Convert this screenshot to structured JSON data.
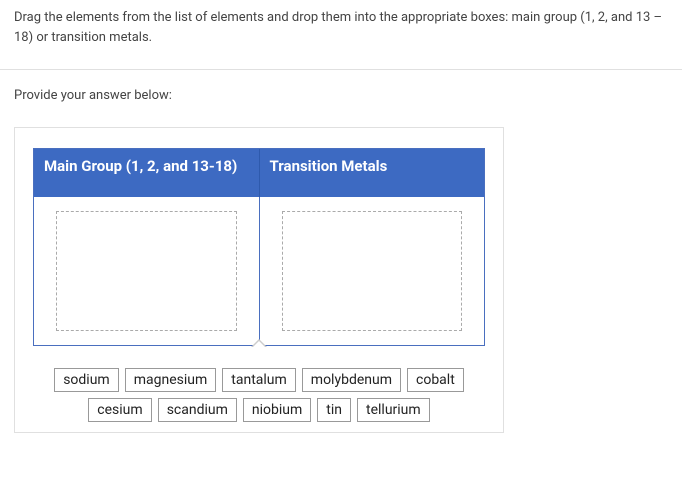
{
  "instructions": "Drag the elements from the list of elements and drop them into the appropriate boxes: main group (1, 2, and 13 – 18) or transition metals.",
  "prompt": "Provide your answer below:",
  "columns": {
    "main_group": "Main Group (1, 2, and 13-18)",
    "transition": "Transition Metals"
  },
  "tiles": [
    "sodium",
    "magnesium",
    "tantalum",
    "molybdenum",
    "cobalt",
    "cesium",
    "scandium",
    "niobium",
    "tin",
    "tellurium"
  ]
}
